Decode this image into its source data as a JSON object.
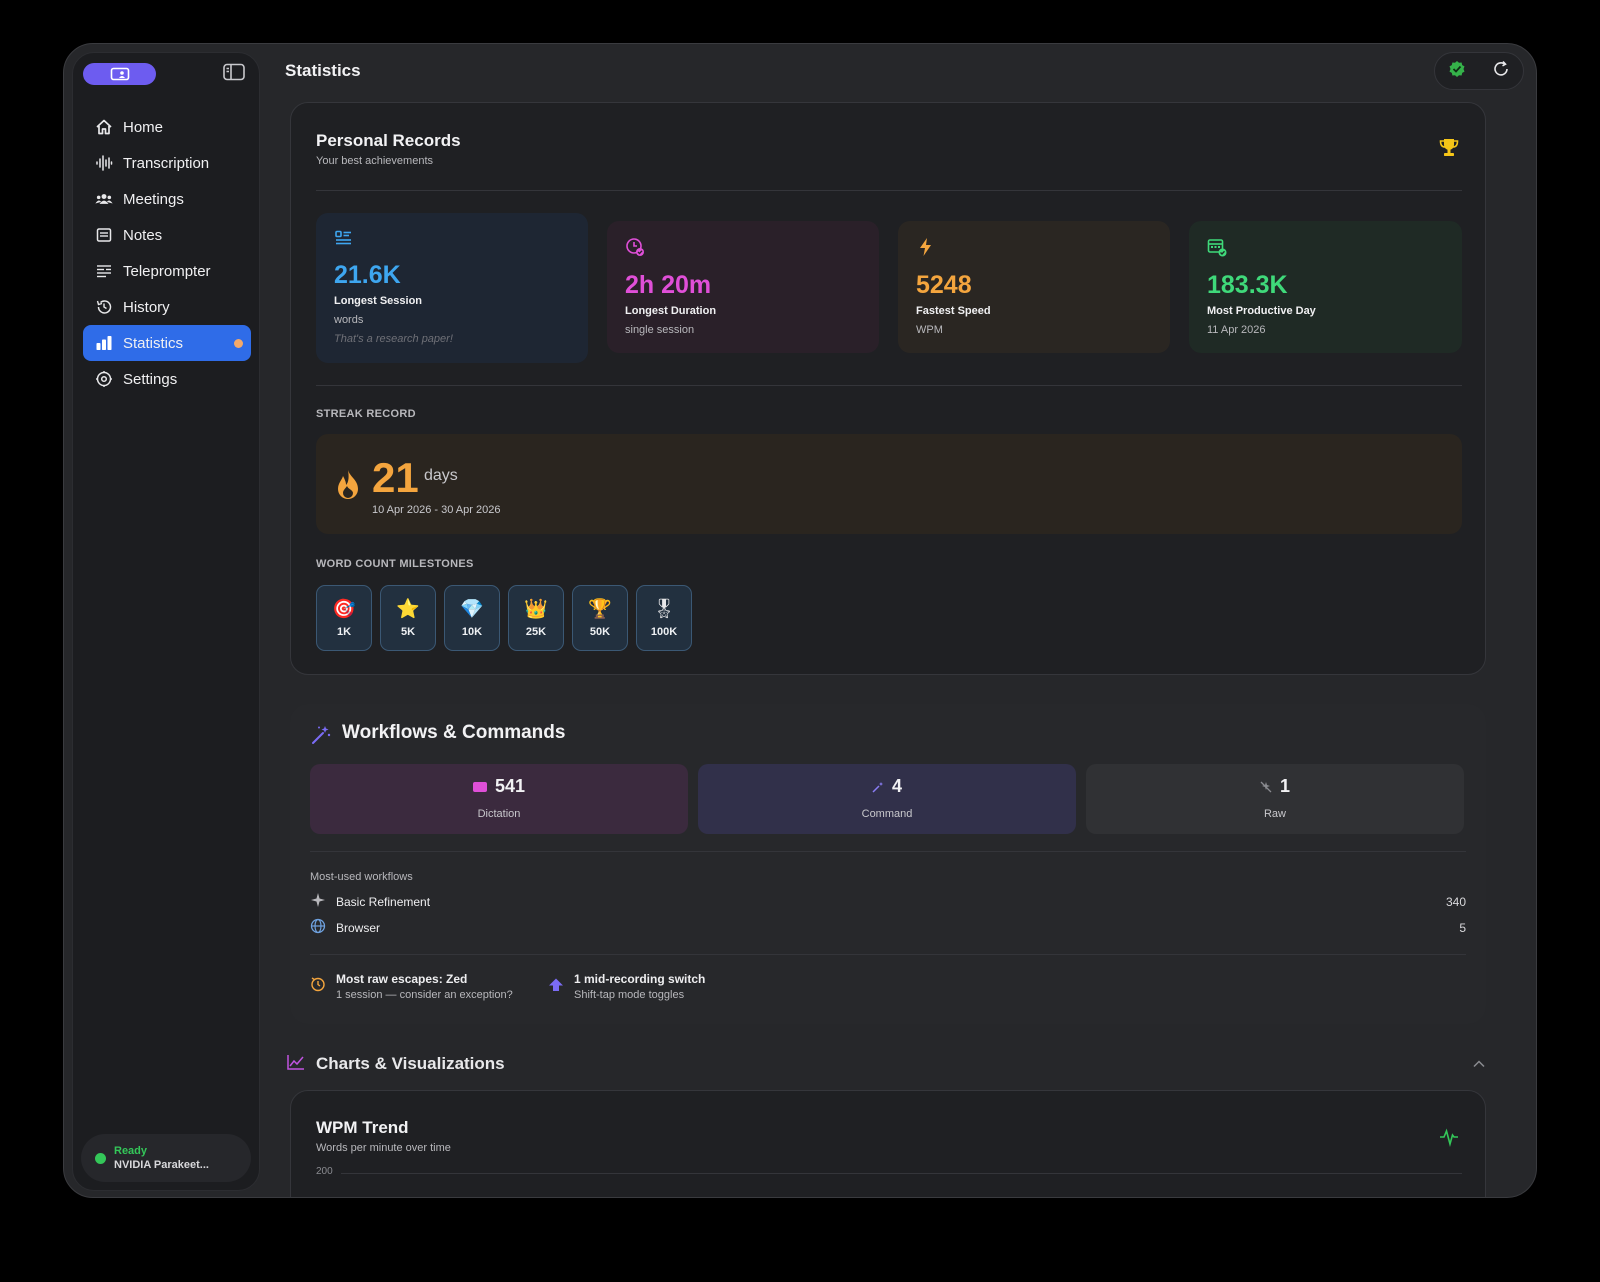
{
  "app": {
    "page_title": "Statistics"
  },
  "sidebar": {
    "items": [
      {
        "label": "Home",
        "icon": "home-icon"
      },
      {
        "label": "Transcription",
        "icon": "waveform-icon"
      },
      {
        "label": "Meetings",
        "icon": "people-icon"
      },
      {
        "label": "Notes",
        "icon": "notes-icon"
      },
      {
        "label": "Teleprompter",
        "icon": "teleprompter-icon"
      },
      {
        "label": "History",
        "icon": "history-icon"
      },
      {
        "label": "Statistics",
        "icon": "bar-chart-icon",
        "active": true
      },
      {
        "label": "Settings",
        "icon": "gear-icon"
      }
    ],
    "status": {
      "state": "Ready",
      "model": "NVIDIA Parakeet..."
    }
  },
  "records": {
    "title": "Personal Records",
    "subtitle": "Your best achievements",
    "tiles": [
      {
        "value": "21.6K",
        "label": "Longest Session",
        "unit": "words",
        "note": "That's a research paper!",
        "color": "#3ea6f0"
      },
      {
        "value": "2h 20m",
        "label": "Longest Duration",
        "unit": "single session",
        "color": "#e04fd8"
      },
      {
        "value": "5248",
        "label": "Fastest Speed",
        "unit": "WPM",
        "color": "#f4a53e"
      },
      {
        "value": "183.3K",
        "label": "Most Productive Day",
        "unit": "11 Apr 2026",
        "color": "#3fd97a"
      }
    ],
    "streak": {
      "section": "STREAK RECORD",
      "value": "21",
      "unit": "days",
      "range": "10 Apr 2026 - 30 Apr 2026"
    },
    "milestones": {
      "section": "WORD COUNT MILESTONES",
      "items": [
        {
          "emoji": "🎯",
          "label": "1K"
        },
        {
          "emoji": "⭐",
          "label": "5K"
        },
        {
          "emoji": "💎",
          "label": "10K"
        },
        {
          "emoji": "👑",
          "label": "25K"
        },
        {
          "emoji": "🏆",
          "label": "50K"
        },
        {
          "emoji": "🎖",
          "label": "100K"
        }
      ]
    }
  },
  "workflows": {
    "title": "Workflows & Commands",
    "modes": [
      {
        "value": "541",
        "label": "Dictation"
      },
      {
        "value": "4",
        "label": "Command"
      },
      {
        "value": "1",
        "label": "Raw"
      }
    ],
    "most_used_label": "Most-used workflows",
    "most_used": [
      {
        "name": "Basic Refinement",
        "count": "340"
      },
      {
        "name": "Browser",
        "count": "5"
      }
    ],
    "insights": [
      {
        "title": "Most raw escapes: Zed",
        "detail": "1 session — consider an exception?"
      },
      {
        "title": "1 mid-recording switch",
        "detail": "Shift-tap mode toggles"
      }
    ]
  },
  "charts": {
    "section_title": "Charts & Visualizations",
    "wpm": {
      "title": "WPM Trend",
      "subtitle": "Words per minute over time",
      "y_top_tick": "200"
    }
  }
}
